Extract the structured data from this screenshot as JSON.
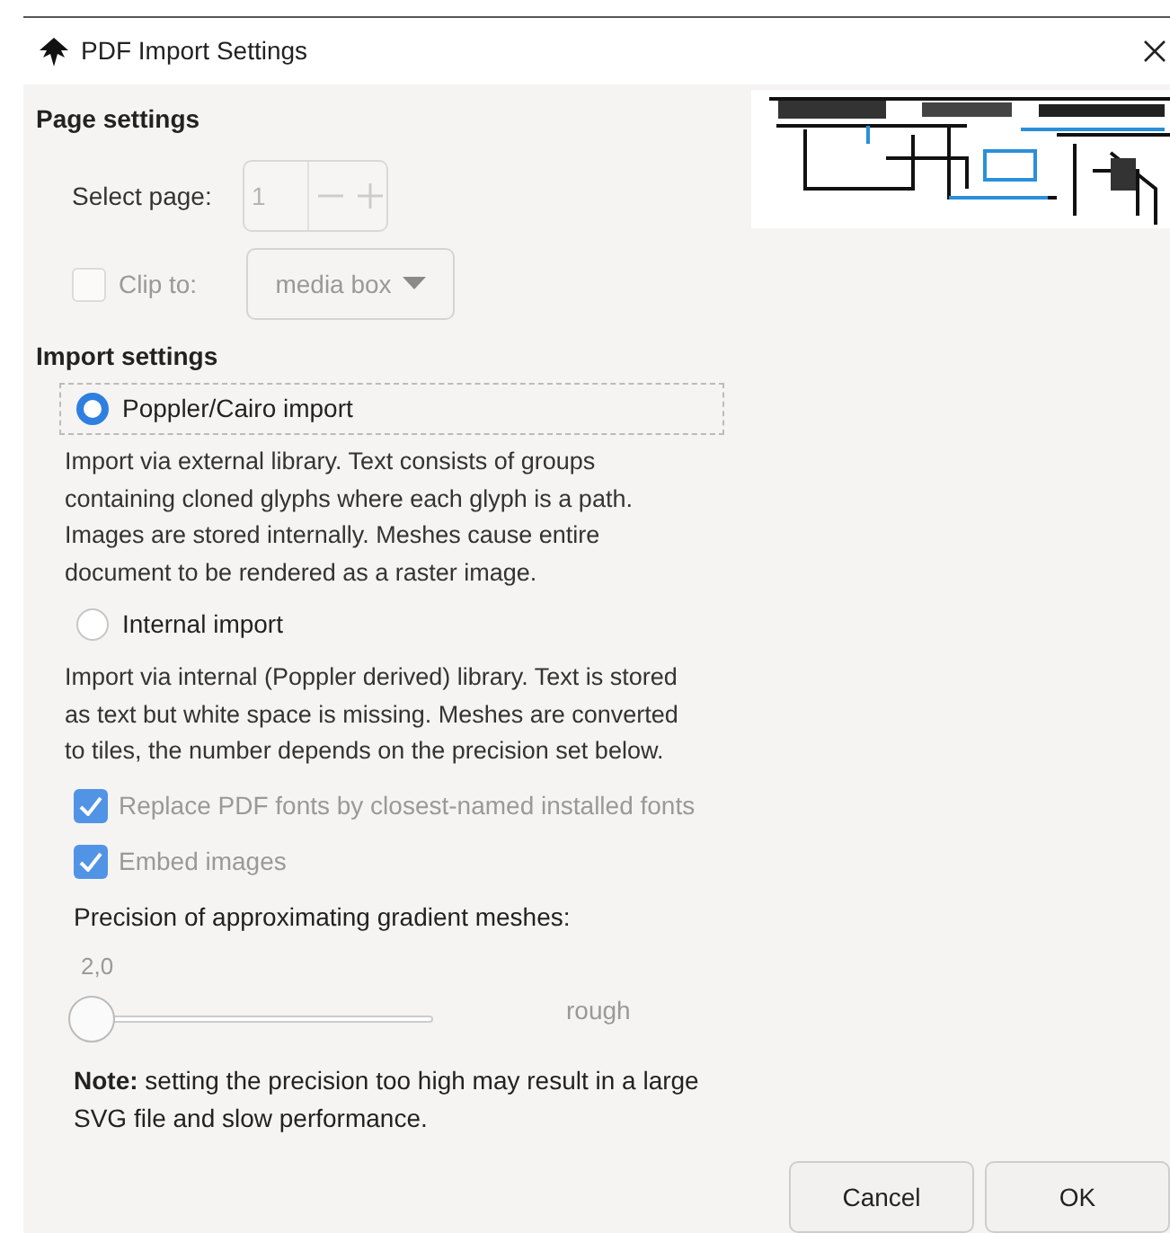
{
  "window": {
    "title": "PDF Import Settings"
  },
  "page_settings": {
    "heading": "Page settings",
    "select_page": {
      "label": "Select page:",
      "value": "1",
      "disabled": true
    },
    "clip": {
      "label": "Clip to:",
      "checked": false,
      "disabled": true,
      "dropdown": "media box"
    }
  },
  "import_settings": {
    "heading": "Import settings",
    "options": [
      {
        "label": "Poppler/Cairo import",
        "selected": true,
        "description": "Import via external library. Text consists of groups containing cloned glyphs where each glyph is a path. Images are stored internally. Meshes cause entire document to be rendered as a raster image."
      },
      {
        "label": "Internal import",
        "selected": false,
        "description": "Import via internal (Poppler derived) library. Text is stored as text but white space is missing. Meshes are converted to tiles, the number depends on the precision set below."
      }
    ],
    "checkboxes": [
      {
        "label": "Replace PDF fonts by closest-named installed fonts",
        "checked": true,
        "disabled": true
      },
      {
        "label": "Embed images",
        "checked": true,
        "disabled": true
      }
    ],
    "precision": {
      "label": "Precision of approximating gradient meshes:",
      "value": "2,0",
      "level": 0,
      "end_label": "rough"
    },
    "note": "**Note:** setting the precision too high may result in a large SVG file and slow performance."
  },
  "buttons": [
    "Cancel",
    "OK"
  ]
}
